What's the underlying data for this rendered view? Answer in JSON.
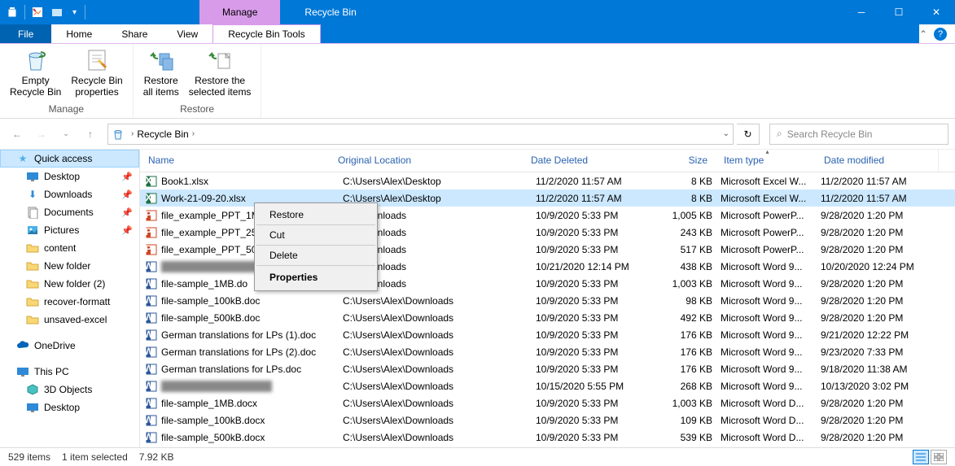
{
  "titlebar": {
    "contextual_label": "Manage",
    "title": "Recycle Bin"
  },
  "ribbon_tabs": {
    "file": "File",
    "home": "Home",
    "share": "Share",
    "view": "View",
    "tools": "Recycle Bin Tools"
  },
  "ribbon": {
    "empty": "Empty\nRecycle Bin",
    "properties": "Recycle Bin\nproperties",
    "restore_all": "Restore\nall items",
    "restore_sel": "Restore the\nselected items",
    "group_manage": "Manage",
    "group_restore": "Restore"
  },
  "breadcrumb": {
    "location": "Recycle Bin"
  },
  "search": {
    "placeholder": "Search Recycle Bin"
  },
  "sidebar": {
    "quick_access": "Quick access",
    "desktop": "Desktop",
    "downloads": "Downloads",
    "documents": "Documents",
    "pictures": "Pictures",
    "content": "content",
    "new_folder": "New folder",
    "new_folder2": "New folder (2)",
    "recover_format": "recover-formatt",
    "unsaved_excel": "unsaved-excel",
    "onedrive": "OneDrive",
    "this_pc": "This PC",
    "objects_3d": "3D Objects",
    "desktop2": "Desktop"
  },
  "columns": {
    "name": "Name",
    "original_location": "Original Location",
    "date_deleted": "Date Deleted",
    "size": "Size",
    "item_type": "Item type",
    "date_modified": "Date modified"
  },
  "files": [
    {
      "icon": "xlsx",
      "name": "Book1.xlsx",
      "loc": "C:\\Users\\Alex\\Desktop",
      "del": "11/2/2020 11:57 AM",
      "size": "8 KB",
      "type": "Microsoft Excel W...",
      "mod": "11/2/2020 11:57 AM"
    },
    {
      "icon": "xlsx",
      "name": "Work-21-09-20.xlsx",
      "loc": "C:\\Users\\Alex\\Desktop",
      "del": "11/2/2020 11:57 AM",
      "size": "8 KB",
      "type": "Microsoft Excel W...",
      "mod": "11/2/2020 11:57 AM",
      "selected": true,
      "loc_truncated": "lex\\Desktop"
    },
    {
      "icon": "pptx",
      "name": "file_example_PPT_1M",
      "loc": "lex\\Downloads",
      "del": "10/9/2020 5:33 PM",
      "size": "1,005 KB",
      "type": "Microsoft PowerP...",
      "mod": "9/28/2020 1:20 PM"
    },
    {
      "icon": "pptx",
      "name": "file_example_PPT_25",
      "loc": "lex\\Downloads",
      "del": "10/9/2020 5:33 PM",
      "size": "243 KB",
      "type": "Microsoft PowerP...",
      "mod": "9/28/2020 1:20 PM"
    },
    {
      "icon": "pptx",
      "name": "file_example_PPT_50",
      "loc": "lex\\Downloads",
      "del": "10/9/2020 5:33 PM",
      "size": "517 KB",
      "type": "Microsoft PowerP...",
      "mod": "9/28/2020 1:20 PM"
    },
    {
      "icon": "docx",
      "name": "",
      "loc": "lex\\Downloads",
      "del": "10/21/2020 12:14 PM",
      "size": "438 KB",
      "type": "Microsoft Word 9...",
      "mod": "10/20/2020 12:24 PM",
      "blurred": true
    },
    {
      "icon": "docx",
      "name": "file-sample_1MB.do",
      "loc": "lex\\Downloads",
      "del": "10/9/2020 5:33 PM",
      "size": "1,003 KB",
      "type": "Microsoft Word 9...",
      "mod": "9/28/2020 1:20 PM"
    },
    {
      "icon": "docx",
      "name": "file-sample_100kB.doc",
      "loc": "C:\\Users\\Alex\\Downloads",
      "del": "10/9/2020 5:33 PM",
      "size": "98 KB",
      "type": "Microsoft Word 9...",
      "mod": "9/28/2020 1:20 PM"
    },
    {
      "icon": "docx",
      "name": "file-sample_500kB.doc",
      "loc": "C:\\Users\\Alex\\Downloads",
      "del": "10/9/2020 5:33 PM",
      "size": "492 KB",
      "type": "Microsoft Word 9...",
      "mod": "9/28/2020 1:20 PM"
    },
    {
      "icon": "docx",
      "name": "German translations for LPs (1).doc",
      "loc": "C:\\Users\\Alex\\Downloads",
      "del": "10/9/2020 5:33 PM",
      "size": "176 KB",
      "type": "Microsoft Word 9...",
      "mod": "9/21/2020 12:22 PM"
    },
    {
      "icon": "docx",
      "name": "German translations for LPs (2).doc",
      "loc": "C:\\Users\\Alex\\Downloads",
      "del": "10/9/2020 5:33 PM",
      "size": "176 KB",
      "type": "Microsoft Word 9...",
      "mod": "9/23/2020 7:33 PM"
    },
    {
      "icon": "docx",
      "name": "German translations for LPs.doc",
      "loc": "C:\\Users\\Alex\\Downloads",
      "del": "10/9/2020 5:33 PM",
      "size": "176 KB",
      "type": "Microsoft Word 9...",
      "mod": "9/18/2020 11:38 AM"
    },
    {
      "icon": "docx",
      "name": "",
      "loc": "C:\\Users\\Alex\\Downloads",
      "del": "10/15/2020 5:55 PM",
      "size": "268 KB",
      "type": "Microsoft Word 9...",
      "mod": "10/13/2020 3:02 PM",
      "blurred": true
    },
    {
      "icon": "docx",
      "name": "file-sample_1MB.docx",
      "loc": "C:\\Users\\Alex\\Downloads",
      "del": "10/9/2020 5:33 PM",
      "size": "1,003 KB",
      "type": "Microsoft Word D...",
      "mod": "9/28/2020 1:20 PM"
    },
    {
      "icon": "docx",
      "name": "file-sample_100kB.docx",
      "loc": "C:\\Users\\Alex\\Downloads",
      "del": "10/9/2020 5:33 PM",
      "size": "109 KB",
      "type": "Microsoft Word D...",
      "mod": "9/28/2020 1:20 PM"
    },
    {
      "icon": "docx",
      "name": "file-sample_500kB.docx",
      "loc": "C:\\Users\\Alex\\Downloads",
      "del": "10/9/2020 5:33 PM",
      "size": "539 KB",
      "type": "Microsoft Word D...",
      "mod": "9/28/2020 1:20 PM"
    }
  ],
  "context_menu": {
    "restore": "Restore",
    "cut": "Cut",
    "delete": "Delete",
    "properties": "Properties"
  },
  "statusbar": {
    "items": "529 items",
    "selected": "1 item selected",
    "size": "7.92 KB"
  }
}
